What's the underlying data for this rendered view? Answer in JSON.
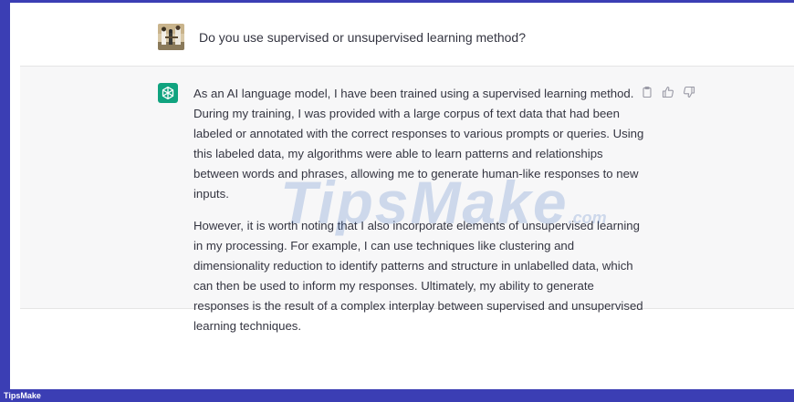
{
  "conversation": {
    "user_message": "Do you use supervised or unsupervised learning method?",
    "assistant_paragraphs": [
      "As an AI language model, I have been trained using a supervised learning method. During my training, I was provided with a large corpus of text data that had been labeled or annotated with the correct responses to various prompts or queries. Using this labeled data, my algorithms were able to learn patterns and relationships between words and phrases, allowing me to generate human-like responses to new inputs.",
      "However, it is worth noting that I also incorporate elements of unsupervised learning in my processing. For example, I can use techniques like clustering and dimensionality reduction to identify patterns and structure in unlabelled data, which can then be used to inform my responses. Ultimately, my ability to generate responses is the result of a complex interplay between supervised and unsupervised learning techniques."
    ]
  },
  "watermark": {
    "main": "TipsMake",
    "suffix": ".com"
  },
  "footer": {
    "label": "TipsMake"
  },
  "icons": {
    "assistant_avatar": "openai-logo-icon",
    "copy": "clipboard-icon",
    "like": "thumbs-up-icon",
    "dislike": "thumbs-down-icon"
  },
  "colors": {
    "frame": "#3b3eb4",
    "assistant_row_bg": "#f7f7f8",
    "assistant_avatar_bg": "#10a37f",
    "text": "#343541"
  }
}
